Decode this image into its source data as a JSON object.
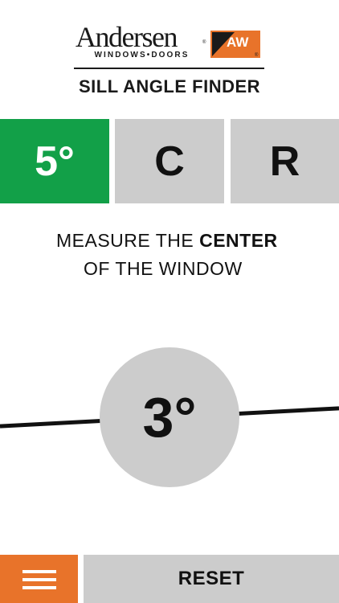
{
  "brand": {
    "name": "Andersen",
    "registered": "®",
    "tagline": "WINDOWS•DOORS",
    "mark_text": "AW",
    "mark_registered": "®",
    "colors": {
      "orange": "#e8732a",
      "dark": "#1a1a1a"
    }
  },
  "app": {
    "title": "SILL ANGLE FINDER"
  },
  "tabs": [
    {
      "label": "5°",
      "active": true
    },
    {
      "label": "C",
      "active": false
    },
    {
      "label": "R",
      "active": false
    }
  ],
  "instruction": {
    "line1_prefix": "MEASURE THE ",
    "line1_strong": "CENTER",
    "line2": "OF THE WINDOW"
  },
  "level": {
    "angle_display": "3°",
    "angle_degrees": 3
  },
  "bottom_bar": {
    "menu_icon": "hamburger-icon",
    "reset_label": "RESET"
  },
  "colors": {
    "active_tab": "#12a048",
    "inactive_tab": "#cccccc",
    "dial": "#cccccc",
    "menu_button": "#e8732a",
    "level_line": "#111111"
  }
}
